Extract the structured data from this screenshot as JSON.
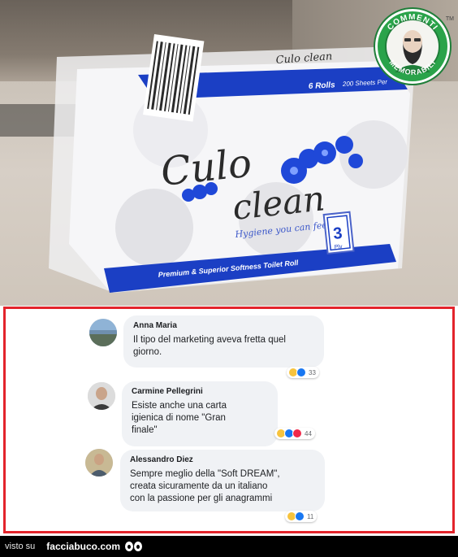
{
  "photo": {
    "package": {
      "brand_line1": "Culo",
      "brand_line2": "clean",
      "tagline": "Hygiene you can feel",
      "rolls": "6 Rolls",
      "sheets": "200 Sheets Per",
      "ply_number": "3",
      "ply_label": "Ply",
      "bottom_strip": "Premium & Superior Softness Toilet Roll",
      "top_label": "Culo clean"
    },
    "badge": {
      "top_text": "COMMENTI",
      "bottom_text": "MEMORABILI",
      "tm": "TM"
    }
  },
  "comments": [
    {
      "name": "Anna Maria",
      "text": "Il tipo del marketing aveva fretta quel\ngiorno.",
      "reaction_count": "33",
      "reactions": [
        "haha",
        "like"
      ]
    },
    {
      "name": "Carmine Pellegrini",
      "text": "Esiste anche una carta\nigienica di nome \"Gran\nfinale\"",
      "reaction_count": "44",
      "reactions": [
        "haha",
        "like",
        "love"
      ]
    },
    {
      "name": "Alessandro Diez",
      "text": "Sempre meglio della \"Soft DREAM\",\ncreata sicuramente da un italiano\ncon la passione per gli anagrammi",
      "reaction_count": "11",
      "reactions": [
        "haha",
        "like"
      ]
    }
  ],
  "footer": {
    "visto": "visto su",
    "site": "facciabuco.com"
  },
  "colors": {
    "frame": "#e3242b",
    "brand_blue": "#1b3fc4",
    "badge_green": "#2aa34a"
  }
}
